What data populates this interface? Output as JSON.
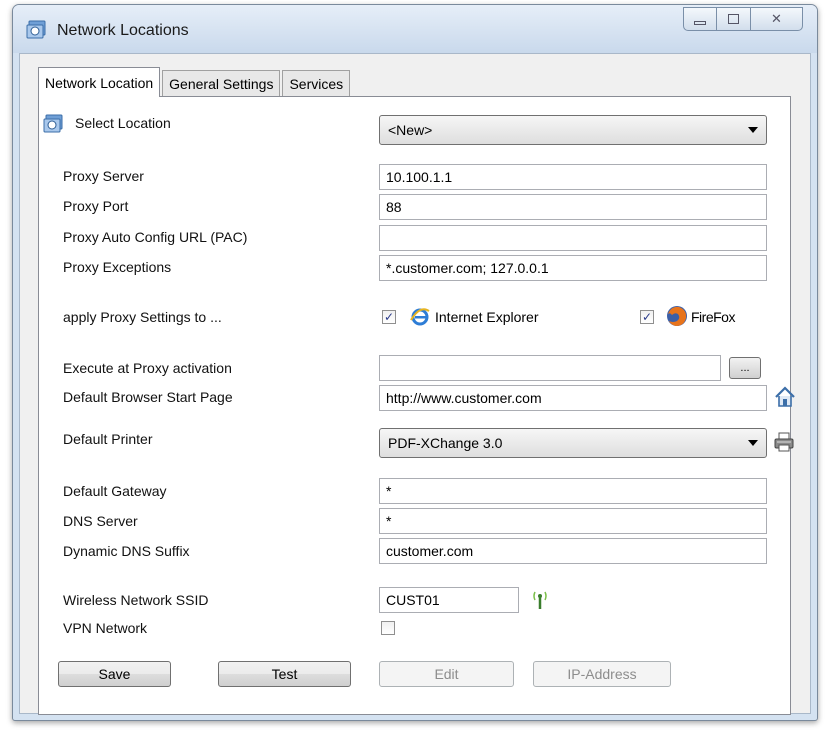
{
  "window": {
    "title": "Network Locations",
    "icon": "network-locations-icon"
  },
  "tabs": [
    {
      "label": "Network Location",
      "active": true
    },
    {
      "label": "General Settings",
      "active": false
    },
    {
      "label": "Services",
      "active": false
    }
  ],
  "select_location": {
    "label": "Select Location",
    "value": "<New>"
  },
  "proxy_server": {
    "label": "Proxy Server",
    "value": "10.100.1.1"
  },
  "proxy_port": {
    "label": "Proxy Port",
    "value": "88"
  },
  "proxy_pac": {
    "label": "Proxy Auto Config URL (PAC)",
    "value": ""
  },
  "proxy_exceptions": {
    "label": "Proxy Exceptions",
    "value": "*.customer.com; 127.0.0.1"
  },
  "apply_proxy": {
    "label": "apply Proxy Settings to ...",
    "ie_label": "Internet Explorer",
    "ie_checked": true,
    "firefox_label": "FireFox",
    "firefox_checked": true
  },
  "execute_activation": {
    "label": "Execute at Proxy activation",
    "value": "",
    "browse_label": "..."
  },
  "start_page": {
    "label": "Default Browser Start Page",
    "value": "http://www.customer.com"
  },
  "printer": {
    "label": "Default Printer",
    "value": "PDF-XChange 3.0"
  },
  "gateway": {
    "label": "Default Gateway",
    "value": "*"
  },
  "dns_server": {
    "label": "DNS Server",
    "value": "*"
  },
  "dns_suffix": {
    "label": "Dynamic DNS Suffix",
    "value": "customer.com"
  },
  "ssid": {
    "label": "Wireless Network SSID",
    "value": "CUST01"
  },
  "vpn": {
    "label": "VPN Network",
    "checked": false
  },
  "buttons": {
    "save": "Save",
    "test": "Test",
    "edit": "Edit",
    "ip_address": "IP-Address"
  },
  "colors": {
    "titlebar": "#c9d9ec",
    "panel_bg": "#ffffff",
    "disabled_text": "#8d8d8d"
  }
}
